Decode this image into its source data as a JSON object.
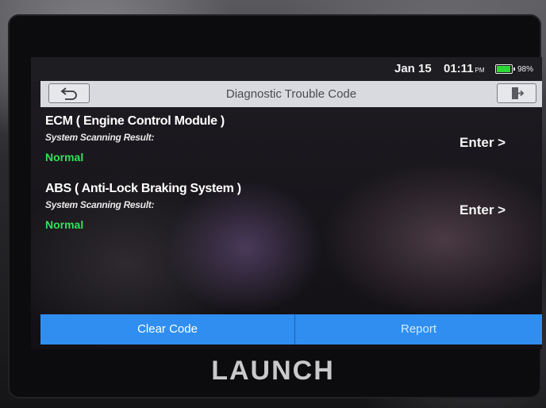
{
  "status_bar": {
    "date": "Jan 15",
    "time": "01:11",
    "ampm": "PM",
    "battery_text": "98%",
    "battery_level": 0.98,
    "battery_color": "#2fd635"
  },
  "header": {
    "title": "Diagnostic Trouble Code",
    "back_icon": "back-arrow-icon",
    "exit_icon": "exit-icon"
  },
  "systems": [
    {
      "name": "ECM ( Engine Control Module )",
      "label": "System Scanning Result:",
      "status": "Normal",
      "enter_label": "Enter >"
    },
    {
      "name": "ABS ( Anti-Lock Braking System )",
      "label": "System Scanning Result:",
      "status": "Normal",
      "enter_label": "Enter >"
    }
  ],
  "actions": {
    "clear_code": "Clear Code",
    "report": "Report",
    "accent_color": "#2f8ef0"
  },
  "brand": "LAUNCH"
}
